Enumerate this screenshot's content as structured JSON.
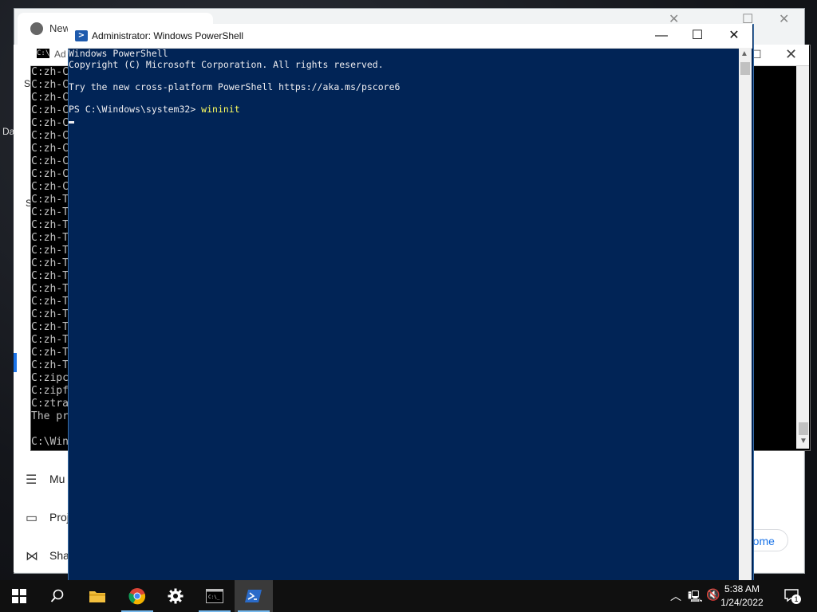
{
  "chrome": {
    "tab_title": "New",
    "side_items": [
      {
        "label": "Mu",
        "icon": "multi-icon"
      },
      {
        "label": "Proj",
        "icon": "project-icon"
      },
      {
        "label": "Sha",
        "icon": "share-icon"
      }
    ],
    "fragment_labels": [
      "S",
      "Da",
      "S"
    ],
    "button_label": "rome"
  },
  "cmd": {
    "title": "Ad",
    "lines": [
      "C:zh-C",
      "C:zh-C",
      "C:zh-C",
      "C:zh-C",
      "C:zh-C",
      "C:zh-C",
      "C:zh-C",
      "C:zh-C",
      "C:zh-C",
      "C:zh-C",
      "C:zh-T",
      "C:zh-T",
      "C:zh-T",
      "C:zh-T",
      "C:zh-T",
      "C:zh-T",
      "C:zh-T",
      "C:zh-T",
      "C:zh-T",
      "C:zh-T",
      "C:zh-T",
      "C:zh-T",
      "C:zh-T",
      "C:zh-T",
      "C:zipc",
      "C:zipf",
      "C:ztra",
      "The pr",
      "",
      "C:\\Win"
    ]
  },
  "powershell": {
    "title": "Administrator: Windows PowerShell",
    "lines": [
      "Windows PowerShell",
      "Copyright (C) Microsoft Corporation. All rights reserved.",
      "",
      "Try the new cross-platform PowerShell https://aka.ms/pscore6",
      "",
      "PS C:\\Windows\\system32> "
    ],
    "command": "wininit"
  },
  "taskbar": {
    "time": "5:38 AM",
    "date": "1/24/2022",
    "notification_count": "1"
  }
}
